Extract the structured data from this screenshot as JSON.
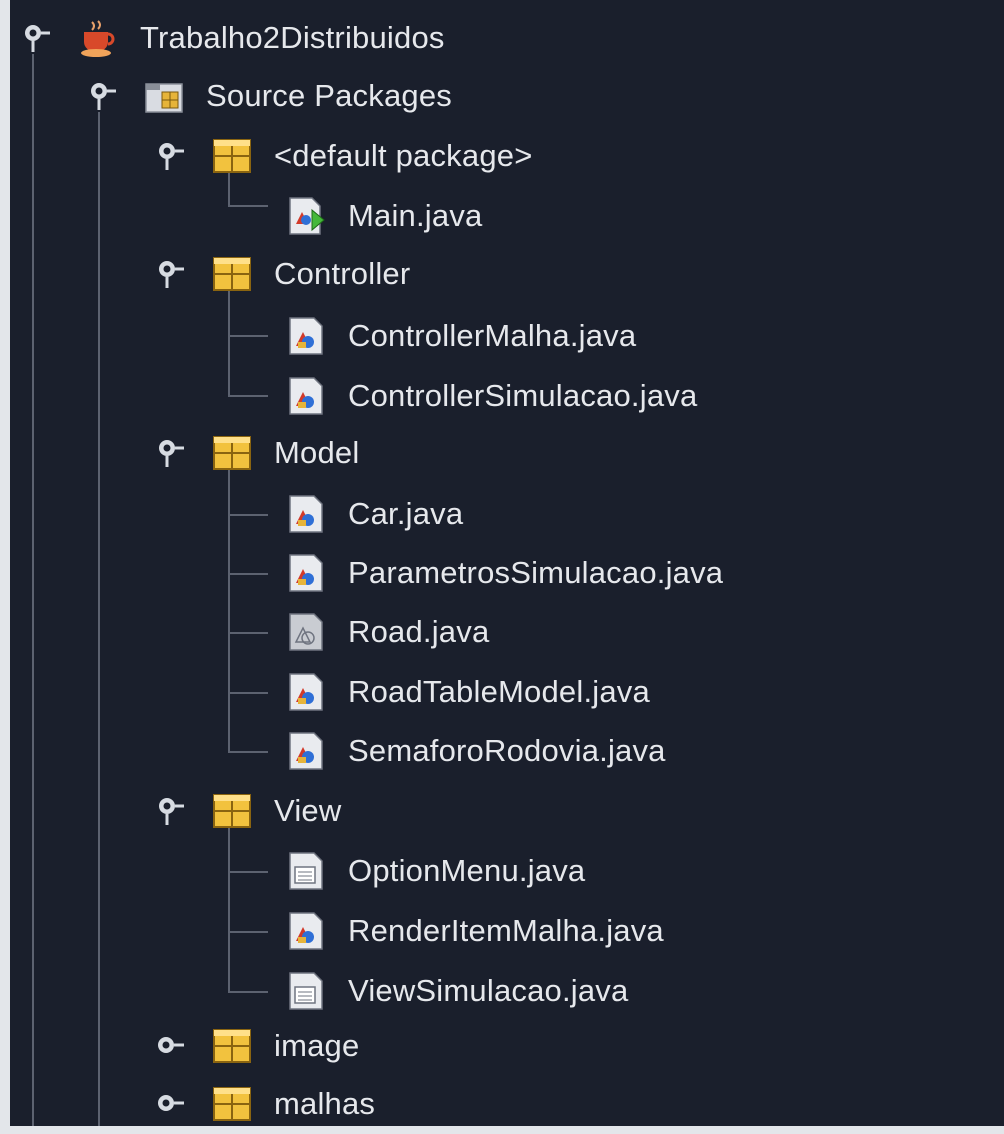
{
  "tree": {
    "project": {
      "label": "Trabalho2Distribuidos",
      "icon": "java-project-cup-icon"
    },
    "source_packages": {
      "label": "Source Packages",
      "icon": "source-packages-folder-icon"
    },
    "packages": [
      {
        "label": "<default package>",
        "icon": "package-icon",
        "expanded": true,
        "files": [
          {
            "label": "Main.java",
            "icon": "java-main-class-icon"
          }
        ]
      },
      {
        "label": "Controller",
        "icon": "package-icon",
        "expanded": true,
        "files": [
          {
            "label": "ControllerMalha.java",
            "icon": "java-class-icon"
          },
          {
            "label": "ControllerSimulacao.java",
            "icon": "java-class-icon"
          }
        ]
      },
      {
        "label": "Model",
        "icon": "package-icon",
        "expanded": true,
        "files": [
          {
            "label": "Car.java",
            "icon": "java-class-icon"
          },
          {
            "label": "ParametrosSimulacao.java",
            "icon": "java-class-icon"
          },
          {
            "label": "Road.java",
            "icon": "java-class-gray-icon"
          },
          {
            "label": "RoadTableModel.java",
            "icon": "java-class-icon"
          },
          {
            "label": "SemaforoRodovia.java",
            "icon": "java-class-icon"
          }
        ]
      },
      {
        "label": "View",
        "icon": "package-icon",
        "expanded": true,
        "files": [
          {
            "label": "OptionMenu.java",
            "icon": "java-form-icon"
          },
          {
            "label": "RenderItemMalha.java",
            "icon": "java-class-icon"
          },
          {
            "label": "ViewSimulacao.java",
            "icon": "java-form-icon"
          }
        ]
      },
      {
        "label": "image",
        "icon": "package-icon",
        "expanded": false,
        "files": []
      },
      {
        "label": "malhas",
        "icon": "package-icon",
        "expanded": false,
        "files": []
      }
    ]
  }
}
